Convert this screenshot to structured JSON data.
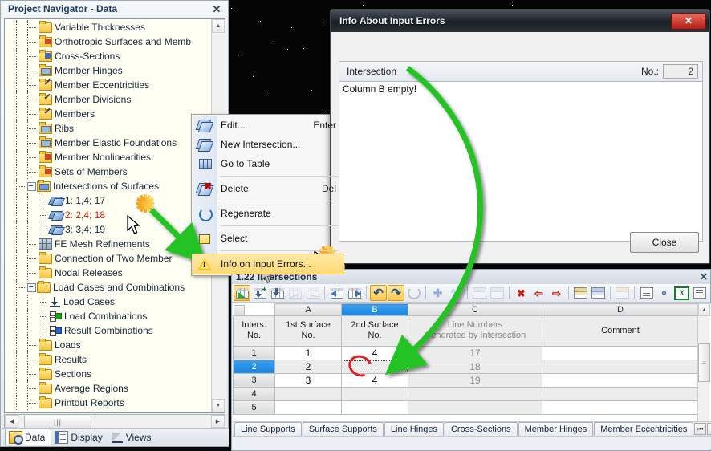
{
  "navigator": {
    "title": "Project Navigator - Data",
    "close_label": "✕",
    "tree": [
      {
        "label": "Variable Thicknesses",
        "icon": "folder-icon",
        "depth": 3,
        "kind": "folder"
      },
      {
        "label": "Orthotropic Surfaces and Memb",
        "icon": "folder-red-icon",
        "depth": 3,
        "kind": "red"
      },
      {
        "label": "Cross-Sections",
        "icon": "folder-blue-icon",
        "depth": 3,
        "kind": "blue"
      },
      {
        "label": "Member Hinges",
        "icon": "folder-cyl-icon",
        "depth": 3,
        "kind": "cyl"
      },
      {
        "label": "Member Eccentricities",
        "icon": "folder-pen-icon",
        "depth": 3,
        "kind": "pen"
      },
      {
        "label": "Member Divisions",
        "icon": "folder-pen-icon",
        "depth": 3,
        "kind": "pen"
      },
      {
        "label": "Members",
        "icon": "folder-pen-icon",
        "depth": 3,
        "kind": "pen"
      },
      {
        "label": "Ribs",
        "icon": "folder-cyl-icon",
        "depth": 3,
        "kind": "cyl"
      },
      {
        "label": "Member Elastic Foundations",
        "icon": "folder-icon",
        "depth": 3,
        "kind": "cyl"
      },
      {
        "label": "Member Nonlinearities",
        "icon": "folder-icon",
        "depth": 3,
        "kind": "red"
      },
      {
        "label": "Sets of Members",
        "icon": "folder-icon",
        "depth": 3,
        "kind": "red"
      },
      {
        "label": "Intersections of Surfaces",
        "icon": "folder-icon",
        "depth": 2,
        "kind": "surf-folder",
        "expander": true
      },
      {
        "label": "1: 1,4; 17",
        "icon": "surface-icon",
        "depth": 4,
        "kind": "surf"
      },
      {
        "label": "2: 2,4; 18",
        "icon": "surface-icon",
        "depth": 4,
        "kind": "surf",
        "error": true
      },
      {
        "label": "3: 3,4; 19",
        "icon": "surface-icon",
        "depth": 4,
        "kind": "surf"
      },
      {
        "label": "FE Mesh Refinements",
        "icon": "mesh-icon",
        "depth": 3,
        "kind": "mesh"
      },
      {
        "label": "Connection of Two Member",
        "icon": "folder-icon",
        "depth": 3,
        "kind": "folder"
      },
      {
        "label": "Nodal Releases",
        "icon": "folder-icon",
        "depth": 3,
        "kind": "folder"
      },
      {
        "label": "Load Cases and Combinations",
        "icon": "folder-icon",
        "depth": 2,
        "kind": "folder",
        "expander": true
      },
      {
        "label": "Load Cases",
        "icon": "arrow-down-icon",
        "depth": 4,
        "kind": "arrowdown"
      },
      {
        "label": "Load Combinations",
        "icon": "combination-green-icon",
        "depth": 4,
        "kind": "combo-green"
      },
      {
        "label": "Result Combinations",
        "icon": "combination-blue-icon",
        "depth": 4,
        "kind": "combo-blue"
      },
      {
        "label": "Loads",
        "icon": "folder-icon",
        "depth": 3,
        "kind": "folder"
      },
      {
        "label": "Results",
        "icon": "folder-icon",
        "depth": 3,
        "kind": "folder"
      },
      {
        "label": "Sections",
        "icon": "folder-icon",
        "depth": 3,
        "kind": "folder"
      },
      {
        "label": "Average Regions",
        "icon": "folder-icon",
        "depth": 3,
        "kind": "folder"
      },
      {
        "label": "Printout Reports",
        "icon": "folder-icon",
        "depth": 3,
        "kind": "folder"
      }
    ],
    "tabs": [
      {
        "label": "Data",
        "icon": "data-icon",
        "active": true
      },
      {
        "label": "Display",
        "icon": "display-icon",
        "active": false
      },
      {
        "label": "Views",
        "icon": "views-icon",
        "active": false
      }
    ]
  },
  "context_menu": {
    "items": [
      {
        "label": "Edit...",
        "shortcut": "Enter",
        "icon": "surface-edit-icon"
      },
      {
        "label": "New Intersection...",
        "shortcut": "",
        "icon": "surface-new-icon"
      },
      {
        "label": "Go to Table",
        "shortcut": "",
        "icon": "grid-table-icon"
      },
      {
        "separator": true
      },
      {
        "label": "Delete",
        "shortcut": "Del",
        "icon": "surface-delete-icon"
      },
      {
        "separator": true
      },
      {
        "label": "Regenerate",
        "shortcut": "",
        "icon": "regenerate-icon"
      },
      {
        "separator": true
      },
      {
        "label": "Select",
        "shortcut": "",
        "icon": "select-square-icon"
      },
      {
        "separator": true
      },
      {
        "label": "Info on Input Errors...",
        "shortcut": "",
        "icon": "warning-icon",
        "highlighted": true
      }
    ]
  },
  "dialog": {
    "title": "Info About Input Errors",
    "close_label": "✕",
    "group_label": "Intersection",
    "no_label": "No.:",
    "no_value": "2",
    "error_text": "Column B empty!",
    "close_button": "Close"
  },
  "table_panel": {
    "title": "1.22 Intersections",
    "close_label": "✕",
    "toolbar": [
      {
        "name": "table-view-button",
        "state": "on",
        "icon": "table-green-icon"
      },
      {
        "name": "insert-row-button",
        "state": "off",
        "icon": "table-plus-icon"
      },
      {
        "name": "import-button",
        "state": "off",
        "icon": "table-down-arrow-icon"
      },
      {
        "name": "graph-button",
        "state": "disabled",
        "icon": "table-line-icon"
      },
      {
        "name": "diagram-button",
        "state": "disabled",
        "icon": "table-zigzag-icon"
      },
      {
        "name": "prev-block-button",
        "state": "off",
        "icon": "arrow-left-table-icon"
      },
      {
        "name": "next-block-button",
        "state": "off",
        "icon": "arrow-right-table-icon"
      },
      {
        "name": "undo-button",
        "state": "on",
        "icon": "undo-icon"
      },
      {
        "name": "redo-button",
        "state": "on",
        "icon": "redo-icon"
      },
      {
        "name": "refresh-button",
        "state": "disabled",
        "icon": "refresh-icon"
      },
      {
        "name": "add-button",
        "state": "disabled",
        "icon": "plus-icon"
      },
      {
        "name": "settings-button",
        "state": "disabled",
        "icon": "wrench-icon"
      },
      {
        "name": "renumber-button",
        "state": "disabled",
        "icon": "two-icon"
      },
      {
        "name": "clear-button",
        "state": "disabled",
        "icon": "x-grid-icon"
      },
      {
        "name": "delete-row-button",
        "state": "off",
        "icon": "delete-red-x-icon"
      },
      {
        "name": "delete-col-left-button",
        "state": "off",
        "icon": "arrow-left-red-icon"
      },
      {
        "name": "delete-col-right-button",
        "state": "off",
        "icon": "arrow-right-red-icon"
      },
      {
        "name": "yellow-table-button",
        "state": "off",
        "icon": "yellow-table-icon"
      },
      {
        "name": "blue-table-button",
        "state": "off",
        "icon": "blue-table-icon"
      },
      {
        "name": "edit-table-button",
        "state": "disabled",
        "icon": "pencil-table-icon"
      },
      {
        "name": "print-button",
        "state": "off",
        "icon": "printer-icon"
      },
      {
        "name": "binoculars-button",
        "state": "off",
        "icon": "binoculars-icon"
      },
      {
        "name": "excel-export-button",
        "state": "off",
        "icon": "excel-icon"
      },
      {
        "name": "doc-export-button",
        "state": "off",
        "icon": "document-icon"
      }
    ],
    "grid": {
      "column_letters": [
        "",
        "A",
        "B",
        "C",
        "D"
      ],
      "selected_column": "B",
      "headers": [
        "Inters.\nNo.",
        "1st Surface\nNo.",
        "2nd Surface\nNo.",
        "Line Numbers\nGenerated by Intersection",
        "Comment"
      ],
      "rows": [
        {
          "no": "1",
          "a": "1",
          "b": "4",
          "c": "17",
          "d": "",
          "selected": false
        },
        {
          "no": "2",
          "a": "2",
          "b": "",
          "c": "18",
          "d": "",
          "selected": true
        },
        {
          "no": "3",
          "a": "3",
          "b": "4",
          "c": "19",
          "d": "",
          "selected": false
        },
        {
          "no": "4",
          "a": "",
          "b": "",
          "c": "",
          "d": "",
          "selected": false
        },
        {
          "no": "5",
          "a": "",
          "b": "",
          "c": "",
          "d": "",
          "selected": false
        }
      ]
    },
    "sheet_tabs": [
      {
        "label": "Line Supports"
      },
      {
        "label": "Surface Supports"
      },
      {
        "label": "Line Hinges"
      },
      {
        "label": "Cross-Sections"
      },
      {
        "label": "Member Hinges"
      },
      {
        "label": "Member Eccentricities"
      }
    ],
    "nav_arrows": [
      "⏮",
      "◀",
      "▶",
      "⏭"
    ]
  },
  "colors": {
    "accent_blue": "#1b84dd",
    "error_red": "#e01b00",
    "highlight_yellow": "#ffd972",
    "annotation_green": "#22c322",
    "burst_orange": "#f6a21e"
  }
}
